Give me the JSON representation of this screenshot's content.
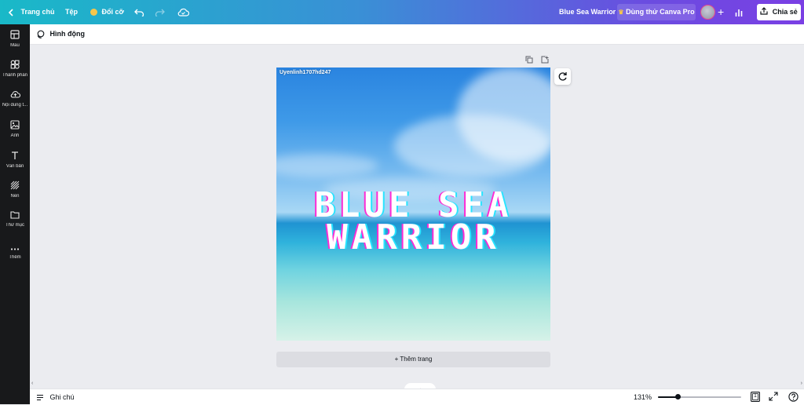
{
  "topbar": {
    "home": "Trang chủ",
    "file": "Tệp",
    "resize": "Đổi cỡ",
    "doc_title": "Blue Sea Warrior",
    "pro_button": "Dùng thử Canva Pro",
    "share": "Chia sẻ"
  },
  "sidebar": {
    "items": [
      {
        "label": "Mẫu",
        "icon": "template-icon"
      },
      {
        "label": "Thành phần",
        "icon": "elements-icon"
      },
      {
        "label": "Nội dung t...",
        "icon": "upload-icon"
      },
      {
        "label": "Ảnh",
        "icon": "photo-icon"
      },
      {
        "label": "Văn bản",
        "icon": "text-icon"
      },
      {
        "label": "Nền",
        "icon": "background-icon"
      },
      {
        "label": "Thư mục",
        "icon": "folder-icon"
      },
      {
        "label": "Thêm",
        "icon": "more-icon"
      }
    ]
  },
  "toolbar": {
    "animate": "Hình động"
  },
  "design": {
    "watermark": "Uyenlinh1707hd247",
    "title_line1": "BLUE SEA",
    "title_line2": "WARRIOR"
  },
  "add_page": "+ Thêm trang",
  "bottom": {
    "notes": "Ghi chú",
    "zoom": "131%",
    "zoom_level_fraction": 0.24,
    "page_count": "1"
  },
  "colors": {
    "topbar_start": "#19b9c8",
    "topbar_end": "#7a3fe4",
    "sidebar_bg": "#18191b",
    "glitch_magenta": "#ff2ad4",
    "glitch_cyan": "#27e4ff"
  }
}
